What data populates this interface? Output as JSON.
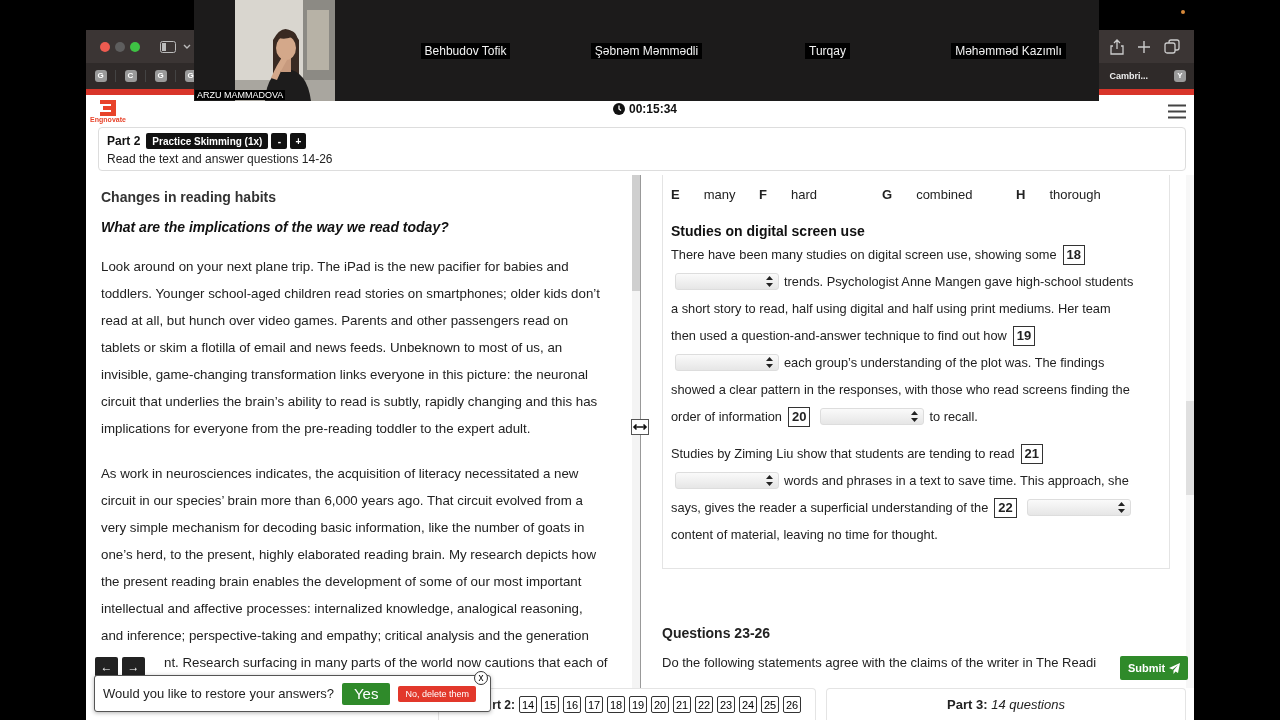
{
  "video_call": {
    "participants": [
      {
        "kind": "video",
        "name": "ARZU MAMMADOVA"
      },
      {
        "kind": "name",
        "name": "Behbudov Tofik"
      },
      {
        "kind": "name",
        "name": "Şəbnəm Məmmədli"
      },
      {
        "kind": "name",
        "name": "Turqay"
      },
      {
        "kind": "name",
        "name": "Məhəmməd Kazımlı"
      }
    ]
  },
  "browser": {
    "left_tabs": [
      "G",
      "C",
      "G",
      "G"
    ],
    "right_tabs": [
      {
        "kind": "labeled",
        "label": "Cambri..."
      },
      {
        "kind": "letter",
        "label": "Y"
      }
    ]
  },
  "header": {
    "logo_text": "Engnovate",
    "timer": "00:15:34"
  },
  "part_bar": {
    "part": "Part 2",
    "speed_button": "Practice Skimming (1x)",
    "minus": "-",
    "plus": "+",
    "instruction": "Read the text and answer questions 14-26"
  },
  "passage": {
    "title": "Changes in reading habits",
    "subtitle": "What are the implications of the way we read today?",
    "paragraphs": [
      "Look around on your next plane trip. The iPad is the new pacifier for babies and toddlers. Younger school-aged children read stories on smartphones; older kids don’t read at all, but hunch over video games. Parents and other passengers read on tablets or skim a flotilla of email and news feeds. Unbeknown to most of us, an invisible, game-changing transformation links everyone in this picture: the neuronal circuit that underlies the brain’s ability to read is subtly, rapidly changing and this has implications for everyone from the pre-reading toddler to the expert adult.",
      "As work in neurosciences indicates, the acquisition of literacy necessitated a new circuit in our species’ brain more than 6,000 years ago. That circuit evolved from a very simple mechanism for decoding basic information, like the number of goats in one’s herd, to the present, highly elaborated reading brain. My research depicts how the present reading brain enables the development of some of our most important intellectual and affective processes: internalized knowledge, analogical reasoning, and inference; perspective-taking and empathy; critical analysis and the generation"
    ],
    "partial_line": "nt. Research surfacing in many parts of the world now cautions that each of"
  },
  "questions": {
    "options": [
      {
        "letter": "E",
        "word": "many"
      },
      {
        "letter": "F",
        "word": "hard"
      },
      {
        "letter": "G",
        "word": "combined"
      },
      {
        "letter": "H",
        "word": "thorough"
      }
    ],
    "heading": "Studies on digital screen use",
    "paragraphs": [
      {
        "lines": [
          [
            {
              "kind": "text",
              "text": "There have been many studies on digital screen use, showing some"
            },
            {
              "kind": "number",
              "text": "18"
            }
          ],
          [
            {
              "kind": "select"
            },
            {
              "kind": "text",
              "text": "trends. Psychologist Anne Mangen gave high-school students"
            }
          ],
          [
            {
              "kind": "text",
              "text": "a short story to read, half using digital and half using print mediums. Her team"
            }
          ],
          [
            {
              "kind": "text",
              "text": "then used a question-and-answer technique to find out how"
            },
            {
              "kind": "number",
              "text": "19"
            }
          ],
          [
            {
              "kind": "select"
            },
            {
              "kind": "text",
              "text": "each group’s understanding of the plot was. The findings"
            }
          ],
          [
            {
              "kind": "text",
              "text": "showed a clear pattern in the responses, with those who read screens finding the"
            }
          ],
          [
            {
              "kind": "text",
              "text": "order of information"
            },
            {
              "kind": "number",
              "text": "20"
            },
            {
              "kind": "select"
            },
            {
              "kind": "text",
              "text": "to recall."
            }
          ]
        ]
      },
      {
        "lines": [
          [
            {
              "kind": "text",
              "text": "Studies by Ziming Liu show that students are tending to read"
            },
            {
              "kind": "number",
              "text": "21"
            }
          ],
          [
            {
              "kind": "select"
            },
            {
              "kind": "text",
              "text": "words and phrases in a text to save time. This approach, she"
            }
          ],
          [
            {
              "kind": "text",
              "text": "says, gives the reader a superficial understanding of the"
            },
            {
              "kind": "number",
              "text": "22"
            },
            {
              "kind": "select"
            }
          ],
          [
            {
              "kind": "text",
              "text": "content of material, leaving no time for thought."
            }
          ]
        ]
      }
    ]
  },
  "next_section": {
    "heading": "Questions 23-26",
    "instruction": "Do the following statements agree with the claims of the writer in The Readi"
  },
  "submit": "Submit",
  "nav": {
    "arrows": [
      "←",
      "→"
    ],
    "part_label": "rt 2:",
    "numbers": [
      "14",
      "15",
      "16",
      "17",
      "18",
      "19",
      "20",
      "21",
      "22",
      "23",
      "24",
      "25",
      "26"
    ],
    "part3": "**Part 3:** *14 questions*"
  },
  "restore_popup": {
    "message": "Would you like to restore your answers?",
    "yes": "Yes",
    "no": "No, delete them",
    "close": "x"
  }
}
